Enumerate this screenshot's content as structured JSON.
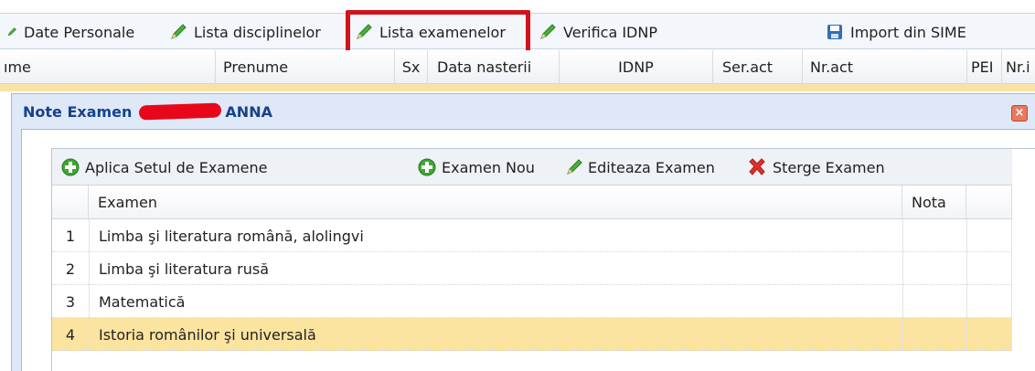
{
  "toolbar": {
    "date_personale": "Date Personale",
    "lista_disciplinelor": "Lista disciplinelor",
    "lista_examenelor": "Lista examenelor",
    "verifica_idnp": "Verifica IDNP",
    "import_sime": "Import din SIME"
  },
  "grid": {
    "columns": [
      "ıme",
      "Prenume",
      "Sx",
      "Data nasterii",
      "IDNP",
      "Ser.act",
      "Nr.act",
      "PEI",
      "Nr.i"
    ]
  },
  "dialog": {
    "title_prefix": "Note Examen",
    "title_suffix": "ANNA",
    "close_label": "×",
    "toolbar": {
      "apply": "Aplica Setul de Examene",
      "new": "Examen Nou",
      "edit": "Editeaza Examen",
      "delete": "Sterge Examen"
    },
    "table": {
      "headers": [
        "Examen",
        "Nota"
      ],
      "rows": [
        {
          "num": "1",
          "examen": "Limba şi literatura română, alolingvi",
          "nota": ""
        },
        {
          "num": "2",
          "examen": "Limba şi literatura rusă",
          "nota": ""
        },
        {
          "num": "3",
          "examen": "Matematică",
          "nota": ""
        },
        {
          "num": "4",
          "examen": "Istoria românilor şi universală",
          "nota": ""
        }
      ],
      "selected_row": 4
    }
  },
  "colors": {
    "highlight": "#d0141d",
    "selected_row": "#fbe3a0",
    "dialog_title": "#15428b"
  }
}
